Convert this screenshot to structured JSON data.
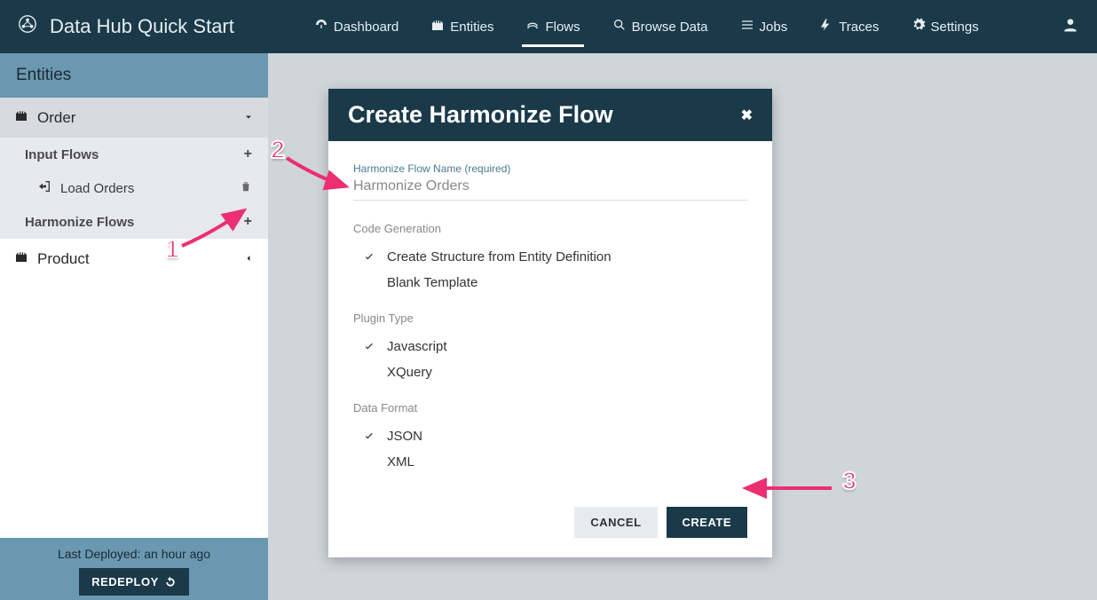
{
  "brand": "Data Hub Quick Start",
  "nav": {
    "dashboard": "Dashboard",
    "entities": "Entities",
    "flows": "Flows",
    "browse": "Browse Data",
    "jobs": "Jobs",
    "traces": "Traces",
    "settings": "Settings"
  },
  "sidebar": {
    "header": "Entities",
    "order": "Order",
    "product": "Product",
    "inputFlows": "Input Flows",
    "harmonizeFlows": "Harmonize Flows",
    "loadOrders": "Load Orders",
    "lastDeployed": "Last Deployed: an hour ago",
    "redeploy": "REDEPLOY"
  },
  "modal": {
    "title": "Create Harmonize Flow",
    "fieldLabel": "Harmonize Flow Name (required)",
    "fieldValue": "Harmonize Orders",
    "codeGen": {
      "label": "Code Generation",
      "option1": "Create Structure from Entity Definition",
      "option2": "Blank Template"
    },
    "pluginType": {
      "label": "Plugin Type",
      "option1": "Javascript",
      "option2": "XQuery"
    },
    "dataFormat": {
      "label": "Data Format",
      "option1": "JSON",
      "option2": "XML"
    },
    "cancel": "CANCEL",
    "create": "CREATE"
  },
  "annotations": {
    "n1": "1",
    "n2": "2",
    "n3": "3"
  }
}
